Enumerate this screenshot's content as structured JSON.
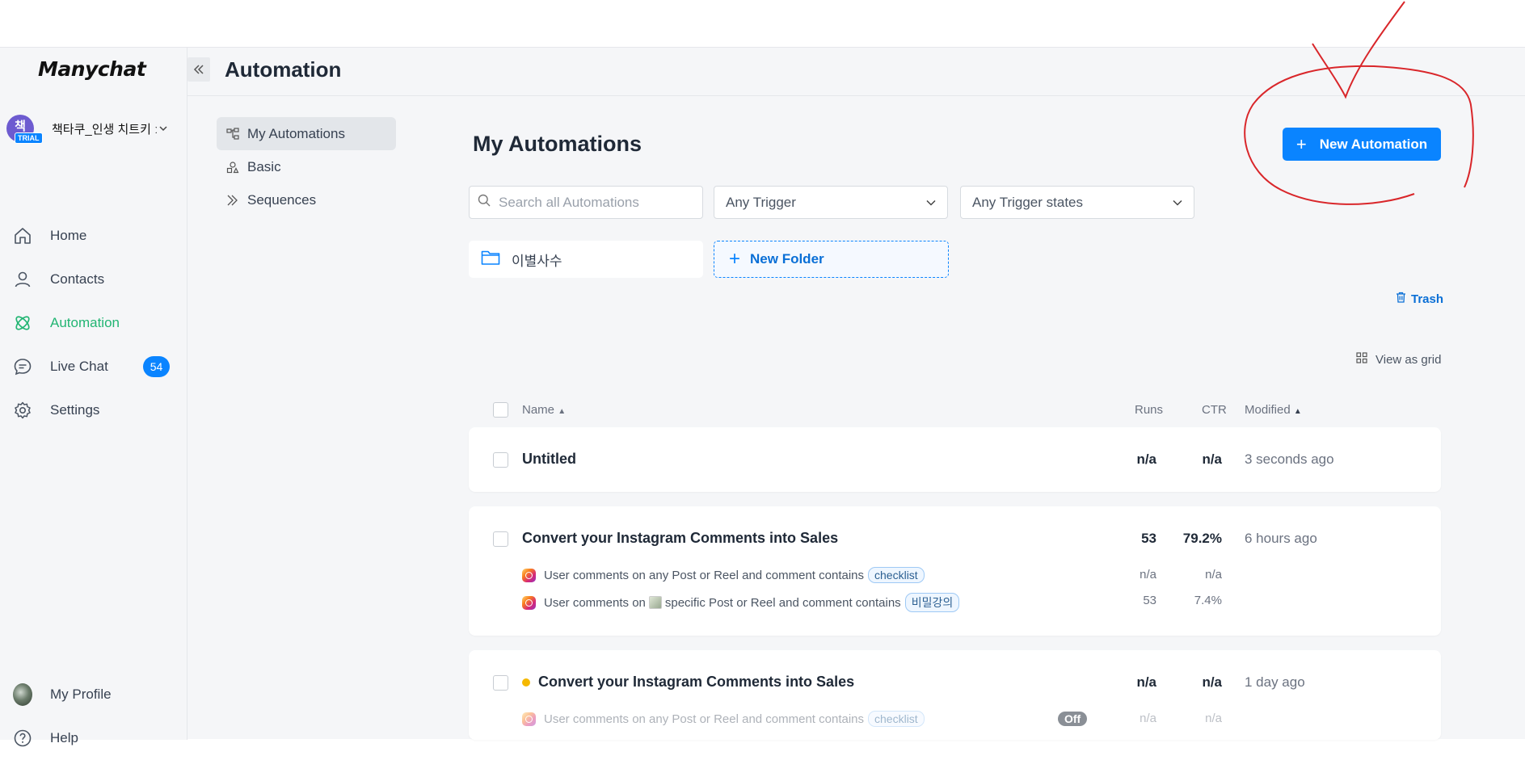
{
  "brand": {
    "logo": "Manychat"
  },
  "account": {
    "initial": "책",
    "trial_label": "TRIAL",
    "name": "책타쿠_인생 치트키 ː"
  },
  "nav": {
    "items": [
      {
        "label": "Home",
        "icon": "home-icon"
      },
      {
        "label": "Contacts",
        "icon": "person-icon"
      },
      {
        "label": "Automation",
        "icon": "automation-icon",
        "active": true
      },
      {
        "label": "Live Chat",
        "icon": "chat-icon",
        "badge": "54"
      },
      {
        "label": "Settings",
        "icon": "gear-icon"
      }
    ],
    "bottom": [
      {
        "label": "My Profile",
        "icon": "profile-avatar"
      },
      {
        "label": "Help",
        "icon": "help-icon"
      }
    ]
  },
  "header": {
    "collapse": "«",
    "title": "Automation"
  },
  "subnav": {
    "items": [
      {
        "label": "My Automations",
        "active": true
      },
      {
        "label": "Basic"
      },
      {
        "label": "Sequences"
      }
    ]
  },
  "main": {
    "title": "My Automations",
    "new_automation_label": "New Automation",
    "search_placeholder": "Search all Automations",
    "trigger_filter": "Any Trigger",
    "trigger_state_filter": "Any Trigger states",
    "folder_name": "이별사수",
    "new_folder_label": "New Folder",
    "trash_label": "Trash",
    "view_grid_label": "View as grid"
  },
  "table": {
    "columns": {
      "name": "Name",
      "runs": "Runs",
      "ctr": "CTR",
      "modified": "Modified"
    },
    "rows": [
      {
        "name": "Untitled",
        "runs": "n/a",
        "ctr": "n/a",
        "modified": "3 seconds ago"
      },
      {
        "name": "Convert your Instagram Comments into Sales",
        "runs": "53",
        "ctr": "79.2%",
        "modified": "6 hours ago",
        "triggers": [
          {
            "text": "User comments on any Post or Reel and comment contains",
            "keyword": "checklist",
            "runs": "n/a",
            "ctr": "n/a"
          },
          {
            "text_before": "User comments on",
            "text_after": "specific Post or Reel and comment contains",
            "keyword": "비밀강의",
            "runs": "53",
            "ctr": "7.4%"
          }
        ]
      },
      {
        "name": "Convert your Instagram Comments into Sales",
        "runs": "n/a",
        "ctr": "n/a",
        "modified": "1 day ago",
        "status_color": "#f5b800",
        "triggers": [
          {
            "text": "User comments on any Post or Reel and comment contains",
            "keyword": "checklist",
            "state": "Off",
            "runs": "n/a",
            "ctr": "n/a"
          }
        ]
      }
    ]
  },
  "colors": {
    "accent": "#0a84ff",
    "active_nav": "#22b573",
    "annotation": "#d9262a"
  }
}
